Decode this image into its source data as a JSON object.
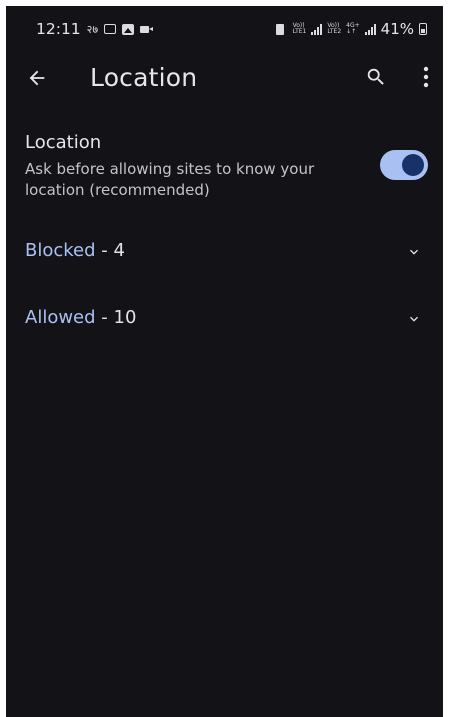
{
  "status_bar": {
    "time": "12:11",
    "notif_text": "२७",
    "battery": "41%",
    "net1": [
      "Vo))",
      "LTE1"
    ],
    "net2": [
      "Vo))",
      "LTE2"
    ],
    "net3": [
      "4G+",
      "↓↑"
    ]
  },
  "app_bar": {
    "title": "Location",
    "back_icon": "arrow-left-icon",
    "search_icon": "search-icon",
    "more_icon": "more-vertical-icon"
  },
  "location_setting": {
    "title": "Location",
    "description": "Ask before allowing sites to know your location (recommended)",
    "toggle_on": true
  },
  "sections": {
    "blocked": {
      "label": "Blocked",
      "separator": " - ",
      "count": "4"
    },
    "allowed": {
      "label": "Allowed",
      "separator": " - ",
      "count": "10"
    }
  },
  "colors": {
    "background": "#131217",
    "accent": "#a9c1f2",
    "toggle_knob": "#163267",
    "text_primary": "#e6e6ea",
    "text_secondary": "#c4c3ca"
  }
}
